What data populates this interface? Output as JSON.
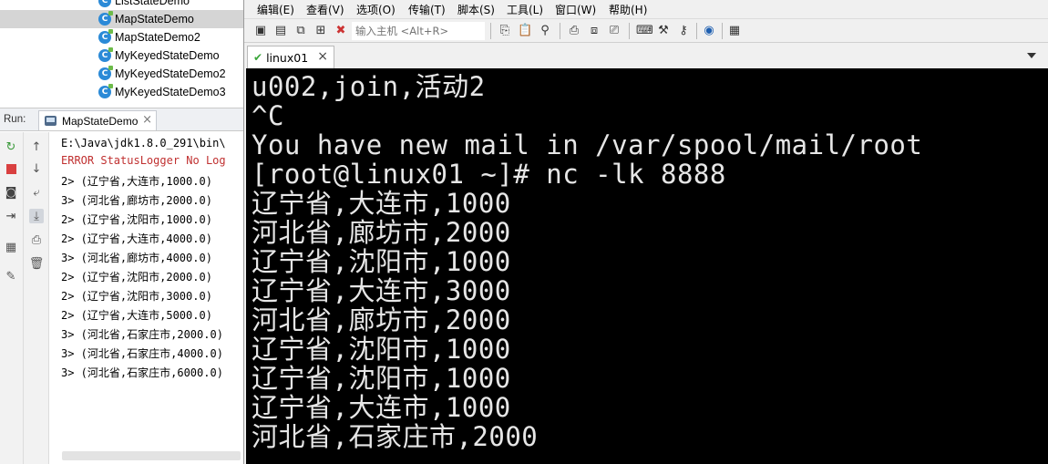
{
  "project_tree": {
    "items": [
      {
        "label": "ListStateDemo",
        "selected": false
      },
      {
        "label": "MapStateDemo",
        "selected": true
      },
      {
        "label": "MapStateDemo2",
        "selected": false
      },
      {
        "label": "MyKeyedStateDemo",
        "selected": false
      },
      {
        "label": "MyKeyedStateDemo2",
        "selected": false
      },
      {
        "label": "MyKeyedStateDemo3",
        "selected": false
      }
    ]
  },
  "run_panel": {
    "label": "Run:",
    "tab_label": "MapStateDemo",
    "tab_close": "×"
  },
  "console": {
    "lines": [
      "E:\\Java\\jdk1.8.0_291\\bin\\",
      "ERROR StatusLogger No Log",
      "2> (辽宁省,大连市,1000.0)",
      "3> (河北省,廊坊市,2000.0)",
      "2> (辽宁省,沈阳市,1000.0)",
      "2> (辽宁省,大连市,4000.0)",
      "3> (河北省,廊坊市,4000.0)",
      "2> (辽宁省,沈阳市,2000.0)",
      "2> (辽宁省,沈阳市,3000.0)",
      "2> (辽宁省,大连市,5000.0)",
      "3> (河北省,石家庄市,2000.0)",
      "3> (河北省,石家庄市,4000.0)",
      "3> (河北省,石家庄市,6000.0)"
    ]
  },
  "terminal_app": {
    "menu": [
      "编辑(E)",
      "查看(V)",
      "选项(O)",
      "传输(T)",
      "脚本(S)",
      "工具(L)",
      "窗口(W)",
      "帮助(H)"
    ],
    "host_placeholder": "输入主机 <Alt+R>",
    "session_tab": "linux01",
    "session_tab_close": "×"
  },
  "terminal": {
    "lines": [
      "u002,join,活动2",
      "^C",
      "You have new mail in /var/spool/mail/root",
      "[root@linux01 ~]# nc -lk 8888",
      "辽宁省,大连市,1000",
      "河北省,廊坊市,2000",
      "辽宁省,沈阳市,1000",
      "辽宁省,大连市,3000",
      "河北省,廊坊市,2000",
      "辽宁省,沈阳市,1000",
      "辽宁省,沈阳市,1000",
      "辽宁省,大连市,1000",
      "河北省,石家庄市,2000"
    ]
  },
  "colors": {
    "terminal_bg": "#000000",
    "terminal_fg": "#e6e6e6",
    "selection": "#d5d5d5",
    "class_icon": "#2b8ad7",
    "error_text": "#c03030"
  }
}
